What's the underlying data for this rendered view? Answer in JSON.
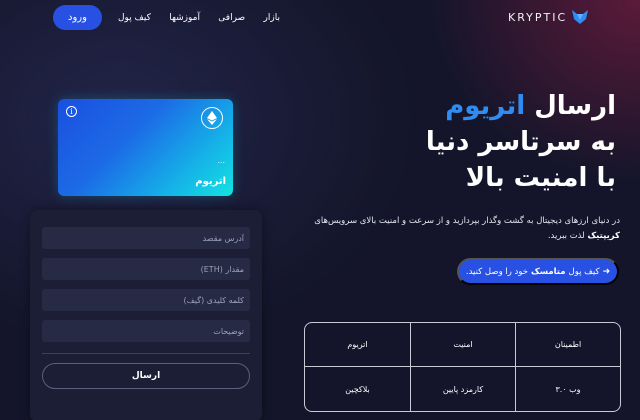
{
  "nav": {
    "login_label": "ورود",
    "links": [
      "بازار",
      "صرافی",
      "آموزشها",
      "کیف پول"
    ],
    "logo_text": "KRYPTIC"
  },
  "card": {
    "name": "اتریوم",
    "dots": "...",
    "info_glyph": "i",
    "icon": "ethereum-icon"
  },
  "form": {
    "fields": [
      {
        "placeholder": "آدرس مقصد"
      },
      {
        "placeholder": "مقدار (ETH)"
      },
      {
        "placeholder": "کلمه کلیدی (گیف)"
      },
      {
        "placeholder": "توضیحات"
      }
    ],
    "submit_label": "ارسال"
  },
  "hero": {
    "title_line1_prefix": "ارسال",
    "title_line1_accent": "اتریوم",
    "title_line2": "به سرتاسر دنیا",
    "title_line3": "با امنیت بالا",
    "desc_part1": "در دنیای ارزهای دیجیتال به گشت وگذار بپردازید و از سرعت و امنیت بالای سرویس‌های",
    "desc_brand": "کریپتیک",
    "desc_part2": "لذت ببرید.",
    "cta_prefix": "کیف پول",
    "cta_bold": "متامسک",
    "cta_suffix": "خود را وصل کنید."
  },
  "features": {
    "cells": [
      "اطمینان",
      "امنیت",
      "اتریوم",
      "وب ۳.۰",
      "کارمزد پایین",
      "بلاکچین"
    ]
  },
  "colors": {
    "accent": "#2851e3",
    "title_accent": "#2f8cf2",
    "background": "#14152a"
  }
}
